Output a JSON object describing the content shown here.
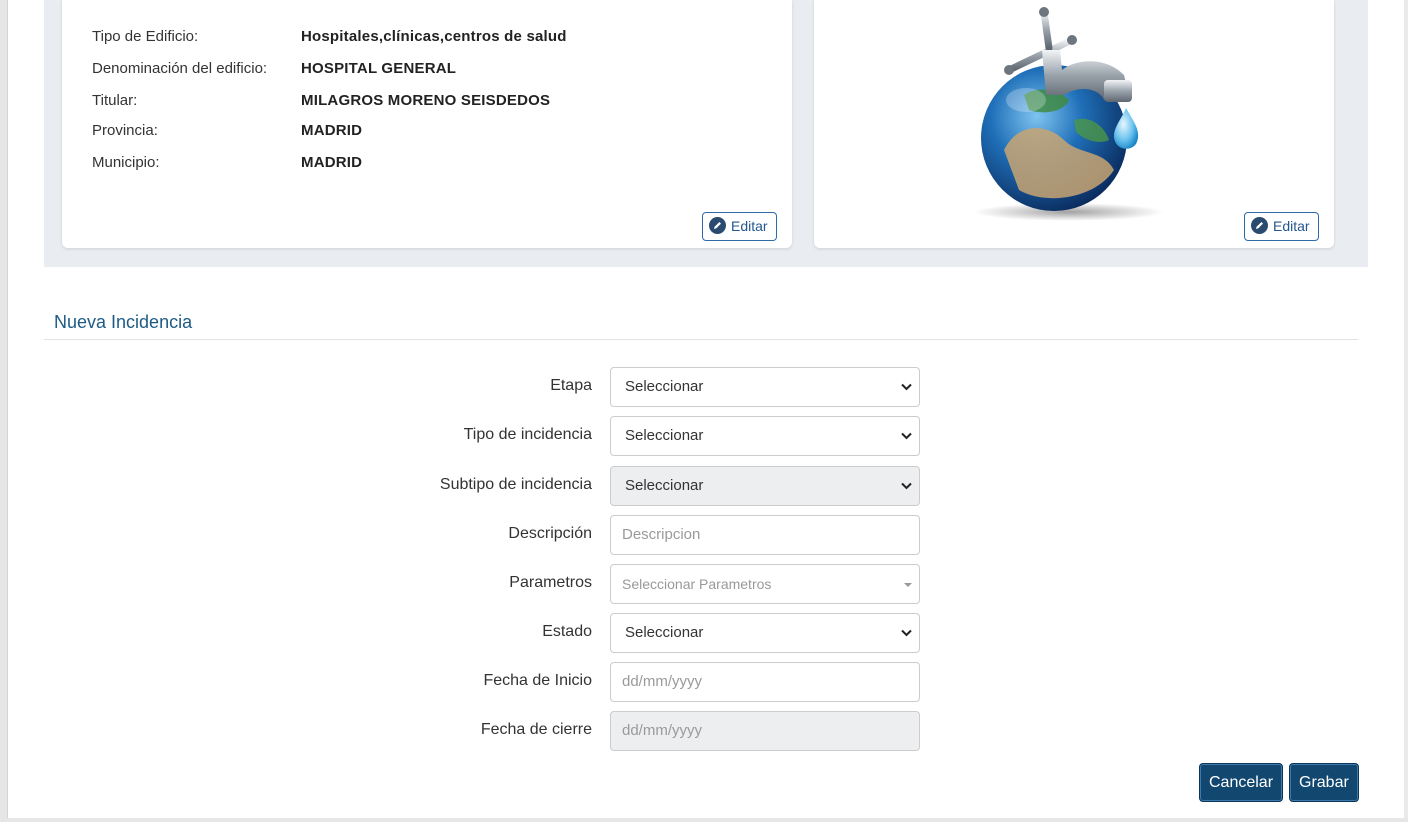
{
  "building": {
    "rows": [
      {
        "label": "Tipo de Edificio:",
        "value": "Hospitales,clínicas,centros de salud"
      },
      {
        "label": "Denominación del edificio:",
        "value": "HOSPITAL GENERAL"
      },
      {
        "label": "Titular:",
        "value": "MILAGROS MORENO SEISDEDOS"
      },
      {
        "label": "Provincia:",
        "value": "MADRID"
      },
      {
        "label": "Municipio:",
        "value": "MADRID"
      }
    ],
    "edit_label": "Editar"
  },
  "image_card": {
    "edit_label": "Editar"
  },
  "form": {
    "title": "Nueva Incidencia",
    "etapa": {
      "label": "Etapa",
      "value": "Seleccionar"
    },
    "tipo": {
      "label": "Tipo de incidencia",
      "value": "Seleccionar"
    },
    "subtipo": {
      "label": "Subtipo de incidencia",
      "value": "Seleccionar"
    },
    "descripcion": {
      "label": "Descripción",
      "placeholder": "Descripcion"
    },
    "parametros": {
      "label": "Parametros",
      "placeholder": "Seleccionar Parametros"
    },
    "estado": {
      "label": "Estado",
      "value": "Seleccionar"
    },
    "fecha_inicio": {
      "label": "Fecha de Inicio",
      "placeholder": "dd/mm/yyyy"
    },
    "fecha_cierre": {
      "label": "Fecha de cierre",
      "placeholder": "dd/mm/yyyy"
    }
  },
  "actions": {
    "cancel": "Cancelar",
    "save": "Grabar"
  },
  "colors": {
    "primary": "#12476f",
    "title": "#1d5b86",
    "band": "#e9edf1"
  }
}
